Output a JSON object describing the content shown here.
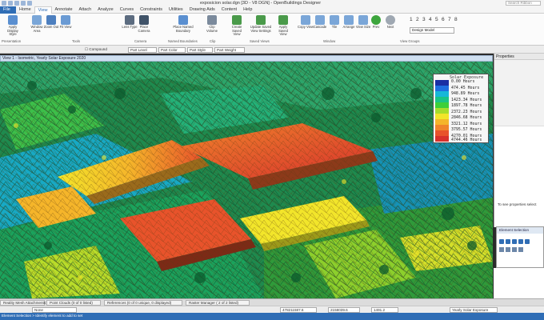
{
  "window": {
    "title": "exposicion solar.dgn [3D - V8 DGN] - OpenBuildings Designer",
    "search_placeholder": "Search Ribbon"
  },
  "ribbon_tabs": [
    "File",
    "Home",
    "View",
    "Annotate",
    "Attach",
    "Analyze",
    "Curves",
    "Constraints",
    "Utilities",
    "Drawing Aids",
    "Content",
    "Help"
  ],
  "active_tab": "View",
  "ribbon": {
    "buttons": [
      {
        "label": "Apply Display Style",
        "icon": "display-style-icon"
      },
      {
        "label": "Window Area",
        "icon": "window-area-icon"
      },
      {
        "label": "Zoom Out",
        "icon": "zoom-out-icon"
      },
      {
        "label": "Fit View",
        "icon": "fit-view-icon"
      },
      {
        "label": "Lens Type",
        "icon": "lens-icon"
      },
      {
        "label": "Place Camera",
        "icon": "camera-icon"
      },
      {
        "label": "Place Named Boundary",
        "icon": "named-boundary-icon"
      },
      {
        "label": "Clip Volume",
        "icon": "clip-volume-icon"
      },
      {
        "label": "Create Saved View",
        "icon": "saved-view-icon"
      },
      {
        "label": "Update Saved View Settings",
        "icon": "update-view-icon"
      },
      {
        "label": "Apply Saved View",
        "icon": "apply-view-icon"
      },
      {
        "label": "Copy View",
        "icon": "copy-view-icon"
      },
      {
        "label": "Cascade",
        "icon": "cascade-icon"
      },
      {
        "label": "Tile",
        "icon": "tile-icon"
      },
      {
        "label": "Arrange",
        "icon": "arrange-icon"
      },
      {
        "label": "View Size",
        "icon": "view-size-icon"
      },
      {
        "label": "Prev",
        "icon": "arrow-left-icon"
      },
      {
        "label": "Next",
        "icon": "arrow-right-icon"
      }
    ],
    "groups": [
      "Presentation",
      "Tools",
      "Camera",
      "Named Boundaries",
      "Clip",
      "Saved Views",
      "Window",
      "View Groups"
    ],
    "view_numbers": [
      "1",
      "2",
      "3",
      "4",
      "5",
      "6",
      "7",
      "8"
    ],
    "design_model": "Design Model"
  },
  "attributes": {
    "compound": "Compound",
    "level": "Part Level",
    "color": "Part Color",
    "style": "Part Style",
    "weight": "Part Weight"
  },
  "view": {
    "title": "View 1 - Isometric, Yearly Solar Exposure 2020"
  },
  "legend": {
    "title": "Solar Exposure",
    "values": [
      "0.00 Hours",
      "474.45 Hours",
      "948.89 Hours",
      "1423.34 Hours",
      "1897.78 Hours",
      "2372.23 Hours",
      "2846.68 Hours",
      "3321.12 Hours",
      "3795.57 Hours",
      "4270.01 Hours",
      "4744.46 Hours"
    ],
    "colors": [
      "#1a2fa3",
      "#1f6fe0",
      "#17b7d8",
      "#19c486",
      "#3ccf3a",
      "#a6dd2c",
      "#f2e52a",
      "#f5b52a",
      "#f0842b",
      "#e8532b",
      "#d8312c"
    ]
  },
  "properties": {
    "title": "Properties",
    "message": "To see properties select"
  },
  "element_selection": {
    "title": "Element Selection"
  },
  "task_tabs": [
    "Reality Mesh Attachments",
    "Point Clouds (0 of 0 listed)",
    "References (0 of 0 unique, 0 displayed)",
    "Raster Manager ( 2 of 2 listed)"
  ],
  "coords": {
    "x": "478211587.6",
    "y": "2158039.6",
    "z": "1491.2",
    "display_style": "Yearly Solar Exposure"
  },
  "status": {
    "text": "Element Selection > Identify element to add to set",
    "level_combo": "None"
  }
}
